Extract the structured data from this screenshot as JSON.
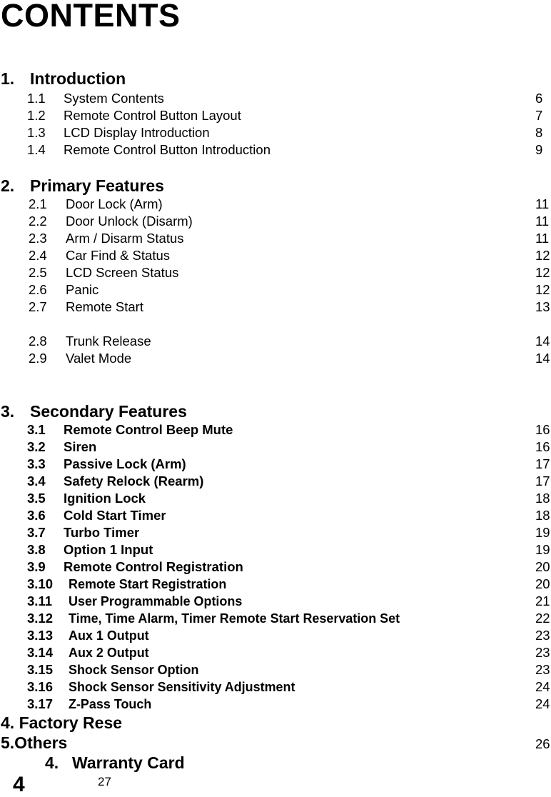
{
  "title": "CONTENTS",
  "sections": [
    {
      "num": "1.",
      "label": "Introduction",
      "items": [
        {
          "num": "1.1",
          "label": "System Contents",
          "page": "6"
        },
        {
          "num": "1.2",
          "label": "Remote Control Button Layout",
          "page": "7"
        },
        {
          "num": "1.3",
          "label": "LCD Display Introduction",
          "page": "8"
        },
        {
          "num": "1.4",
          "label": "Remote Control Button Introduction",
          "page": "9"
        }
      ]
    },
    {
      "num": "2.",
      "label": "Primary Features",
      "items": [
        {
          "num": "2.1",
          "label": "Door Lock (Arm)",
          "page": "11"
        },
        {
          "num": "2.2",
          "label": "Door Unlock (Disarm)",
          "page": "11"
        },
        {
          "num": "2.3",
          "label": "Arm / Disarm Status",
          "page": "11"
        },
        {
          "num": "2.4",
          "label": "Car Find & Status",
          "page": "12"
        },
        {
          "num": "2.5",
          "label": "LCD Screen Status",
          "page": "12"
        },
        {
          "num": "2.6",
          "label": "Panic",
          "page": "12"
        },
        {
          "num": "2.7",
          "label": "Remote Start",
          "page": "13"
        },
        {
          "num": "2.8",
          "label": "Trunk Release",
          "page": "14"
        },
        {
          "num": "2.9",
          "label": "Valet Mode",
          "page": "14"
        }
      ]
    },
    {
      "num": "3.",
      "label": "Secondary Features",
      "items": [
        {
          "num": "3.1",
          "label": "Remote Control Beep Mute",
          "page": "16"
        },
        {
          "num": "3.2",
          "label": "Siren",
          "page": "16"
        },
        {
          "num": "3.3",
          "label": "Passive Lock (Arm)",
          "page": "17"
        },
        {
          "num": "3.4",
          "label": "Safety Relock (Rearm)",
          "page": "17"
        },
        {
          "num": "3.5",
          "label": "Ignition Lock",
          "page": "18"
        },
        {
          "num": "3.6",
          "label": "Cold Start Timer",
          "page": "18"
        },
        {
          "num": "3.7",
          "label": "Turbo Timer",
          "page": "19"
        },
        {
          "num": "3.8",
          "label": "Option 1 Input",
          "page": "19"
        },
        {
          "num": "3.9",
          "label": "Remote Control Registration",
          "page": "20"
        },
        {
          "num": "3.10",
          "label": "Remote Start Registration",
          "page": "20"
        },
        {
          "num": "3.11",
          "label": "User Programmable Options",
          "page": "21"
        },
        {
          "num": "3.12",
          "label": "Time, Time Alarm, Timer Remote Start Reservation Set",
          "page": "22"
        },
        {
          "num": "3.13",
          "label": "Aux 1 Output",
          "page": "23"
        },
        {
          "num": "3.14",
          "label": "Aux 2 Output",
          "page": "23"
        },
        {
          "num": "3.15",
          "label": "Shock Sensor Option",
          "page": "23"
        },
        {
          "num": "3.16",
          "label": "Shock Sensor Sensitivity Adjustment",
          "page": "24"
        },
        {
          "num": "3.17",
          "label": "Z-Pass Touch",
          "page": "24"
        }
      ]
    }
  ],
  "factory_reset": "4. Factory Rese",
  "others": {
    "label": "5.Others",
    "page": "26"
  },
  "warranty": {
    "num": "4.",
    "label": "Warranty Card",
    "page": "27"
  },
  "page_number": "4"
}
